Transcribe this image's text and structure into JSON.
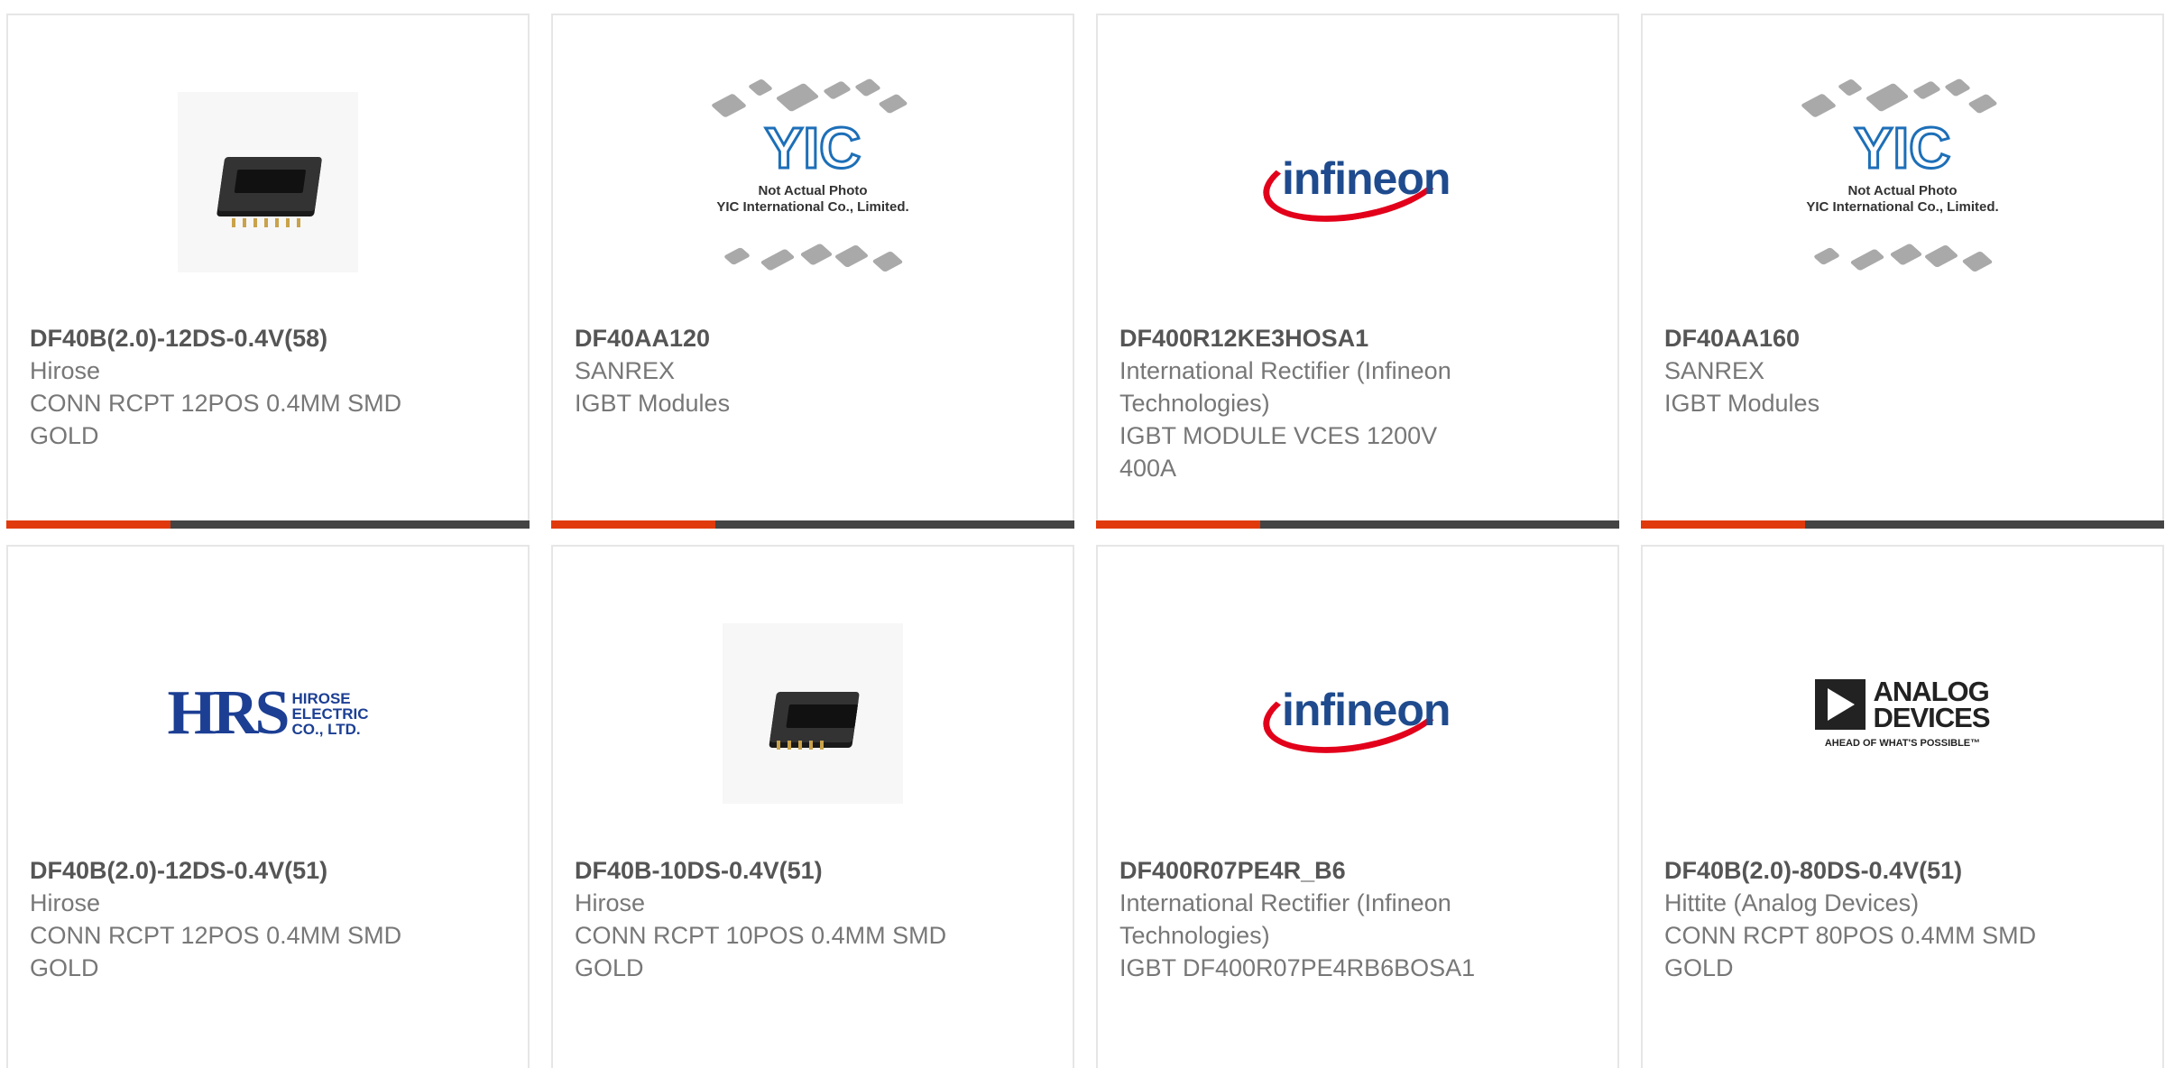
{
  "colors": {
    "accent": "#e03a0c",
    "bar": "#444444",
    "border": "#e6e6e6",
    "part_text": "#555555",
    "body_text": "#777777"
  },
  "products": [
    {
      "part": "DF40B(2.0)-12DS-0.4V(58)",
      "manufacturer": "Hirose",
      "description": "CONN RCPT 12POS 0.4MM SMD GOLD",
      "image": "connector-photo"
    },
    {
      "part": "DF40AA120",
      "manufacturer": "SANREX",
      "description": "IGBT Modules",
      "image": "yic-placeholder"
    },
    {
      "part": "DF400R12KE3HOSA1",
      "manufacturer": "International Rectifier (Infineon Technologies)",
      "description": "IGBT MODULE VCES 1200V 400A",
      "image": "infineon-logo"
    },
    {
      "part": "DF40AA160",
      "manufacturer": "SANREX",
      "description": "IGBT Modules",
      "image": "yic-placeholder"
    },
    {
      "part": "DF40B(2.0)-12DS-0.4V(51)",
      "manufacturer": "Hirose",
      "description": "CONN RCPT 12POS 0.4MM SMD GOLD",
      "image": "hrs-logo"
    },
    {
      "part": "DF40B-10DS-0.4V(51)",
      "manufacturer": "Hirose",
      "description": "CONN RCPT 10POS 0.4MM SMD GOLD",
      "image": "connector-photo"
    },
    {
      "part": "DF400R07PE4R_B6",
      "manufacturer": "International Rectifier (Infineon Technologies)",
      "description": "IGBT DF400R07PE4RB6BOSA1",
      "image": "infineon-logo"
    },
    {
      "part": "DF40B(2.0)-80DS-0.4V(51)",
      "manufacturer": "Hittite (Analog Devices)",
      "description": "CONN RCPT 80POS 0.4MM SMD GOLD",
      "image": "analog-devices-logo"
    }
  ],
  "logos": {
    "yic_mark": "YIC",
    "yic_line1": "Not Actual Photo",
    "yic_line2": "YIC International Co., Limited.",
    "infineon_word": "infineon",
    "hrs_mark": "HRS",
    "hrs_line1": "HIROSE",
    "hrs_line2": "ELECTRIC",
    "hrs_line3": "CO., LTD.",
    "adi_line1": "ANALOG",
    "adi_line2": "DEVICES",
    "adi_tagline": "AHEAD OF WHAT'S POSSIBLE™"
  }
}
